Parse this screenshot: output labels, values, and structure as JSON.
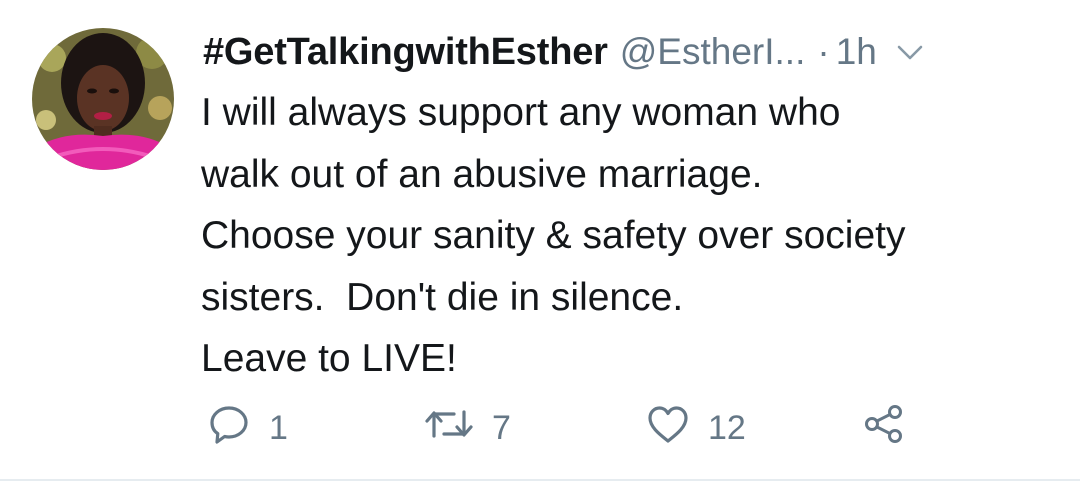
{
  "tweet": {
    "display_name": "#GetTalkingwithEsther",
    "handle": "@EstherI...",
    "separator": "·",
    "time": "1h",
    "lines": [
      "I will always support any woman who",
      "walk out of an abusive marriage.",
      "Choose your sanity & safety over society",
      "sisters.  Don't die in silence.",
      "Leave to LIVE!"
    ]
  },
  "actions": {
    "reply_count": "1",
    "retweet_count": "7",
    "like_count": "12"
  },
  "icons": {
    "reply": "reply-icon",
    "retweet": "retweet-icon",
    "like": "heart-icon",
    "share": "share-icon",
    "menu": "chevron-down-icon"
  },
  "colors": {
    "text": "#14171a",
    "secondary": "#657786",
    "avatar_outfit": "#e0279b"
  }
}
